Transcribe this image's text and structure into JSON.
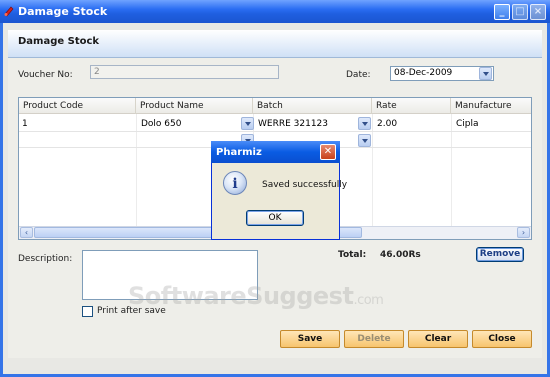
{
  "window": {
    "title": "Damage Stock",
    "controls": [
      "minimize",
      "maximize",
      "close"
    ]
  },
  "form": {
    "header_title": "Damage Stock",
    "voucher_label": "Voucher No:",
    "voucher_value": "2",
    "date_label": "Date:",
    "date_value": "08-Dec-2009",
    "description_label": "Description:",
    "description_value": "",
    "print_after_save_label": "Print after save",
    "print_after_save_checked": false,
    "total_label": "Total:",
    "total_value": "46.00Rs",
    "remove_label": "Remove"
  },
  "grid": {
    "columns": [
      "Product Code",
      "Product Name",
      "Batch",
      "Rate",
      "Manufacture"
    ],
    "rows": [
      {
        "product_code": "1",
        "product_name": "Dolo 650",
        "batch": "WERRE 321123",
        "rate": "2.00",
        "manufacture": "Cipla"
      }
    ]
  },
  "buttons": {
    "save": "Save",
    "delete": "Delete",
    "clear": "Clear",
    "close": "Close"
  },
  "dialog": {
    "title": "Pharmiz",
    "message": "Saved successfully",
    "ok": "OK",
    "icon": "info-icon"
  },
  "watermark": {
    "main": "SoftwareSuggest",
    "suffix": ".com"
  },
  "colors": {
    "titlebar": "#2a6df2",
    "button_orange": "#f7c46e",
    "dialog_bg": "#ece9d8"
  }
}
